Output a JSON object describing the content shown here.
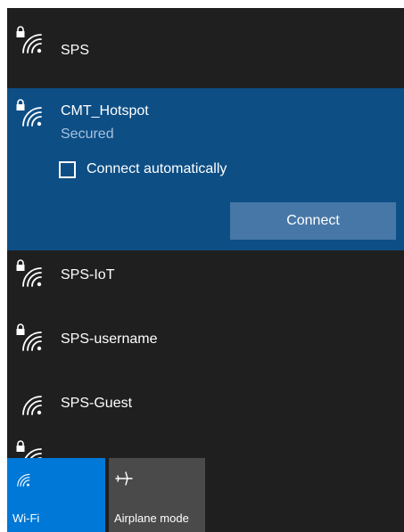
{
  "networks": [
    {
      "name": "SPS",
      "secured": true
    },
    {
      "name": "CMT_Hotspot",
      "secured": true,
      "status": "Secured",
      "selected": true
    },
    {
      "name": "SPS-IoT",
      "secured": true
    },
    {
      "name": "SPS-username",
      "secured": true
    },
    {
      "name": "SPS-Guest",
      "secured": false
    }
  ],
  "selected_network": {
    "connect_automatically_label": "Connect automatically",
    "connect_automatically_checked": false,
    "connect_button_label": "Connect"
  },
  "quick_actions": {
    "wifi": {
      "label": "Wi-Fi",
      "icon": "wifi-icon",
      "active": true
    },
    "airplane": {
      "label": "Airplane mode",
      "icon": "airplane-icon",
      "active": false
    }
  },
  "colors": {
    "panel_background": "#1f1f1f",
    "selected_background": "#0d4e85",
    "connect_button": "#4677a7",
    "wifi_tile_active": "#0078d7",
    "airplane_tile": "#4a4a4a"
  }
}
